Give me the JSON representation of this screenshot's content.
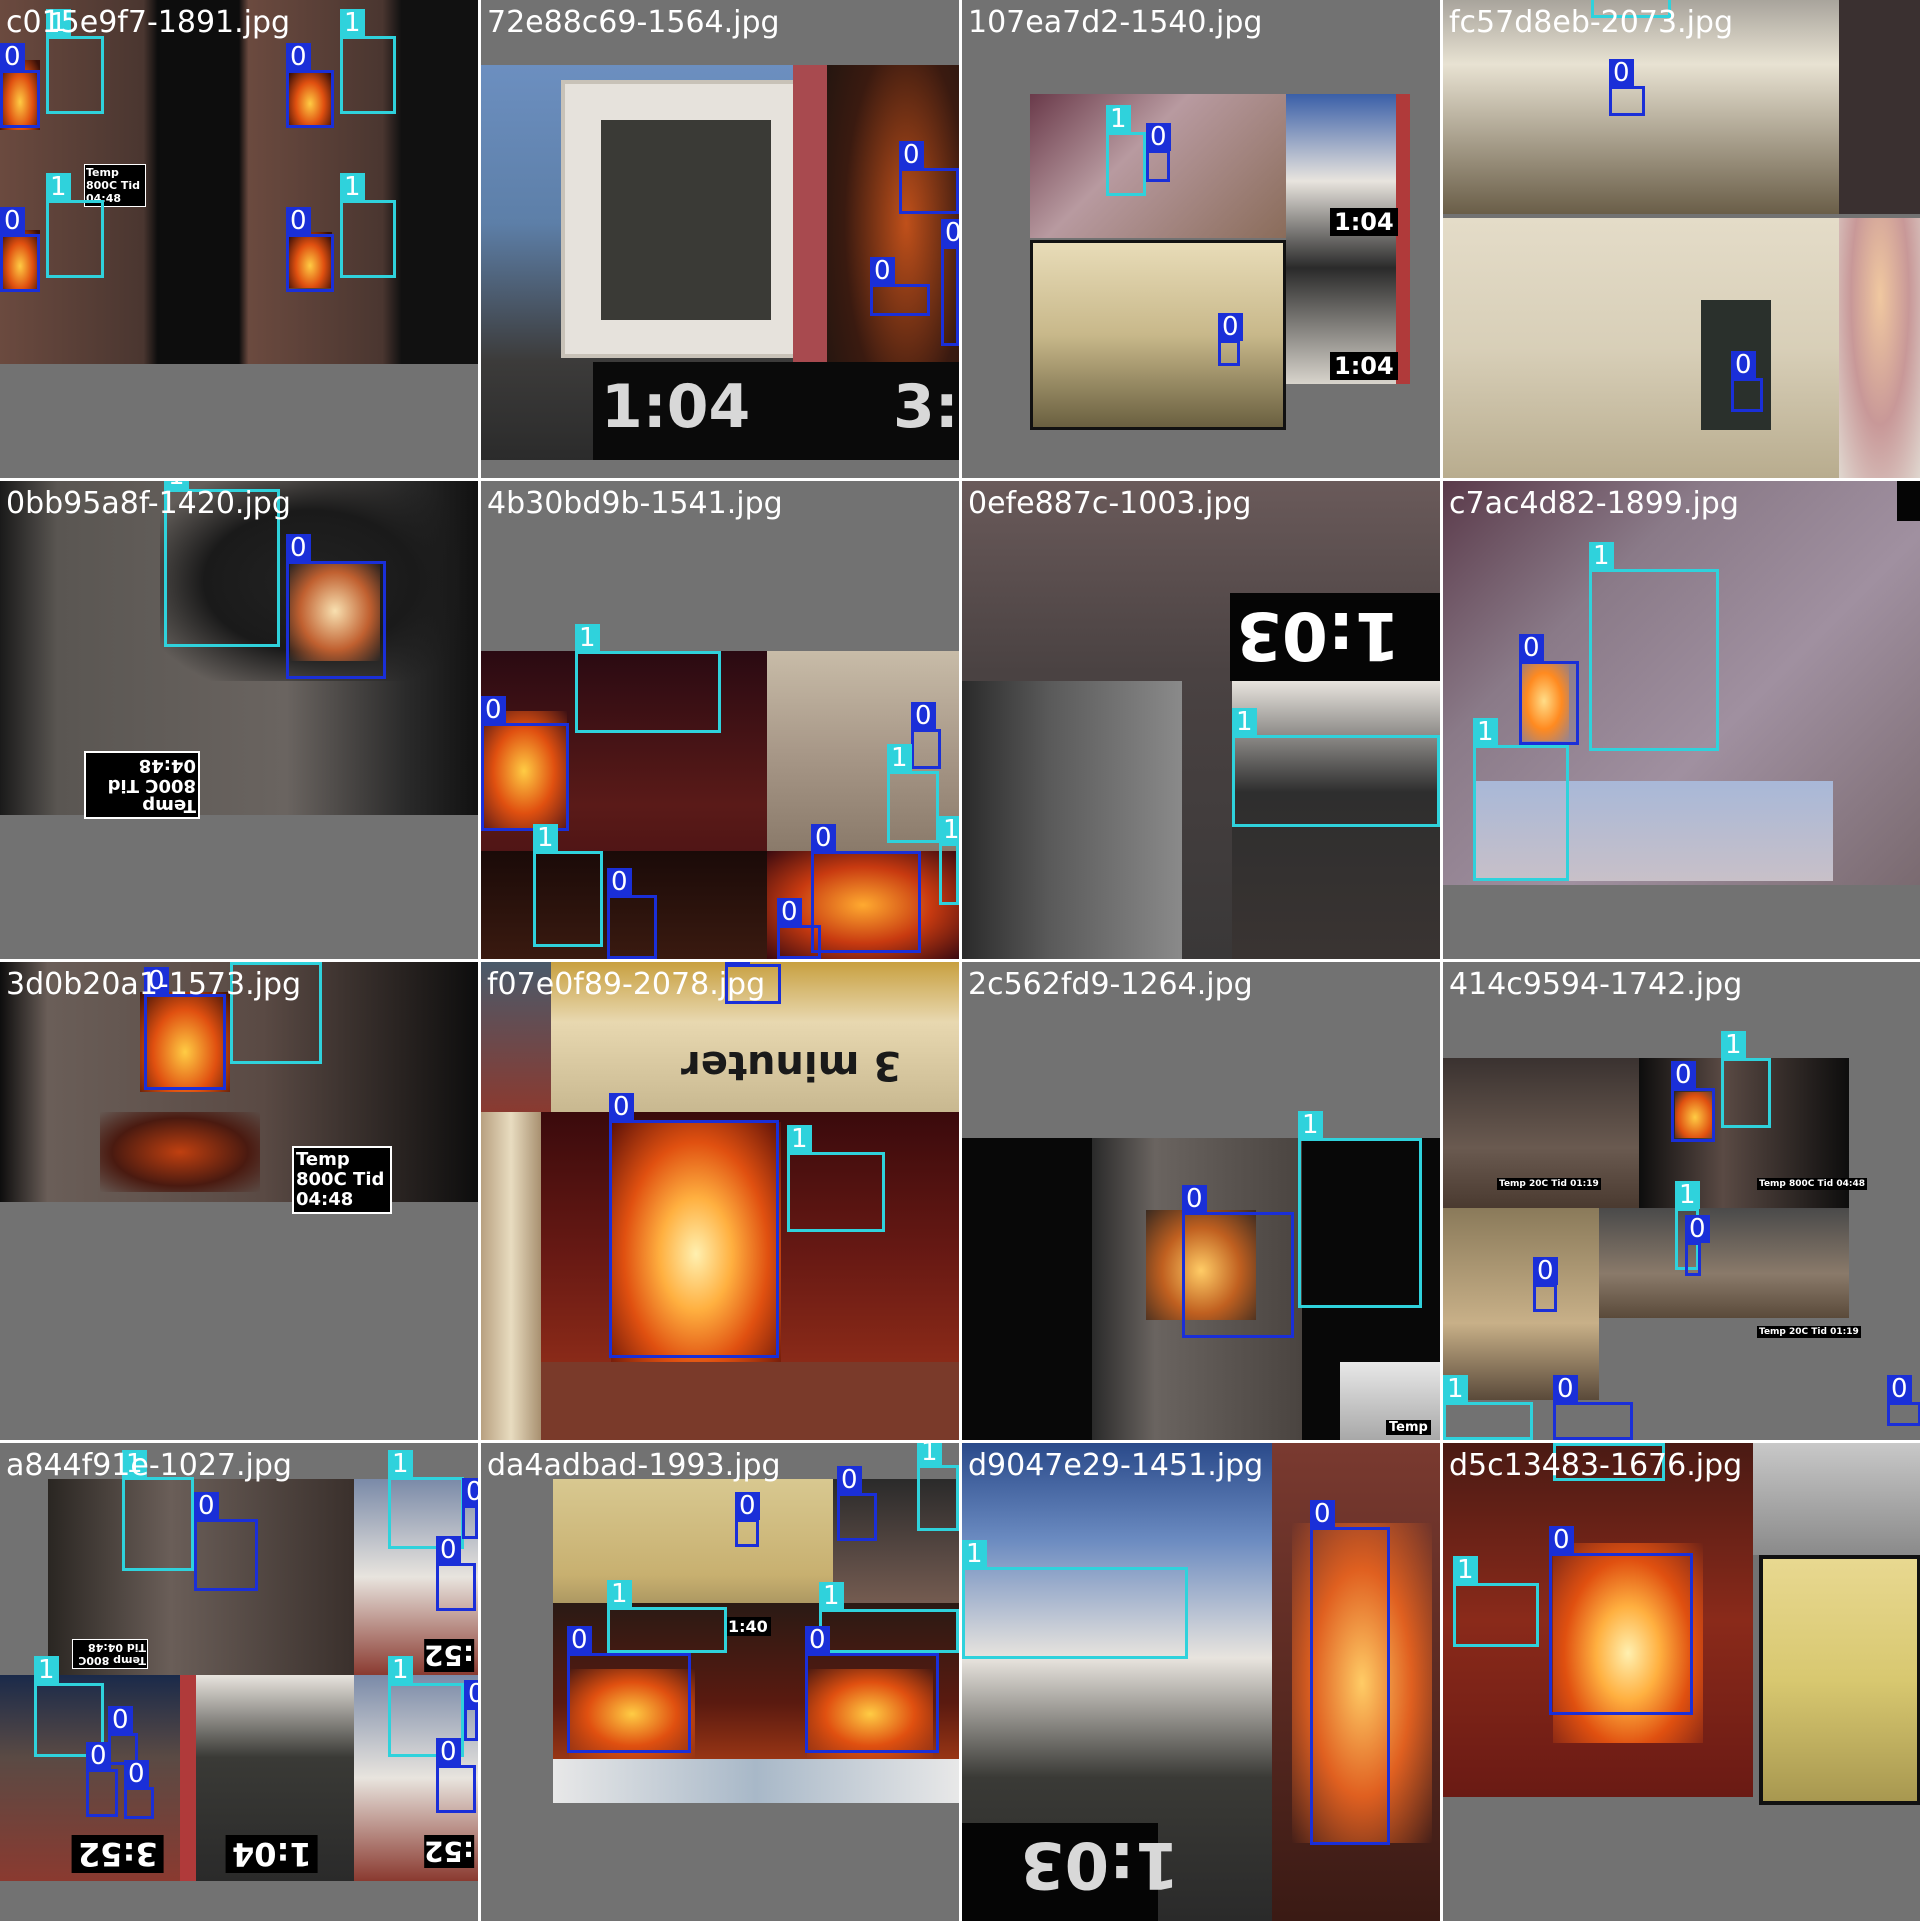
{
  "grid": {
    "tiles": [
      {
        "filename": "c015e9f7-1891.jpg",
        "boxes": [
          "0",
          "1",
          "0",
          "1",
          "0",
          "1",
          "0",
          "1"
        ],
        "overlays": [
          "Temp 800C Tid 04:48"
        ]
      },
      {
        "filename": "72e88c69-1564.jpg",
        "boxes": [
          "0",
          "0",
          "0"
        ],
        "overlays": [
          "1:04",
          "3:5"
        ]
      },
      {
        "filename": "107ea7d2-1540.jpg",
        "boxes": [
          "1",
          "0",
          "0"
        ],
        "overlays": [
          "1:04",
          "1:04"
        ]
      },
      {
        "filename": "fc57d8eb-2073.jpg",
        "boxes": [
          "1",
          "0",
          "0"
        ],
        "overlays": []
      },
      {
        "filename": "0bb95a8f-1420.jpg",
        "boxes": [
          "1",
          "0"
        ],
        "overlays": [
          "Temp 800C Tid 04:48"
        ]
      },
      {
        "filename": "4b30bd9b-1541.jpg",
        "boxes": [
          "1",
          "0",
          "1",
          "0",
          "0",
          "1",
          "0",
          "1",
          "0"
        ],
        "overlays": []
      },
      {
        "filename": "0efe887c-1003.jpg",
        "boxes": [
          "1"
        ],
        "overlays": [
          "1:03"
        ]
      },
      {
        "filename": "c7ac4d82-1899.jpg",
        "boxes": [
          "1",
          "0",
          "1"
        ],
        "overlays": []
      },
      {
        "filename": "3d0b20a1-1573.jpg",
        "boxes": [
          "0",
          "1"
        ],
        "overlays": [
          "Temp 800C Tid 04:48"
        ]
      },
      {
        "filename": "f07e0f89-2078.jpg",
        "boxes": [
          "0",
          "0",
          "1"
        ],
        "overlays": [
          "3 minuter"
        ]
      },
      {
        "filename": "2c562fd9-1264.jpg",
        "boxes": [
          "0",
          "1"
        ],
        "overlays": [
          "Temp"
        ]
      },
      {
        "filename": "414c9594-1742.jpg",
        "boxes": [
          "0",
          "1",
          "1",
          "0",
          "0",
          "1",
          "0",
          "0"
        ],
        "overlays": [
          "Temp 20C Tid 01:19",
          "Temp 800C Tid 04:48",
          "Temp 20C Tid 01:19"
        ]
      },
      {
        "filename": "a844f91e-1027.jpg",
        "boxes": [
          "1",
          "0",
          "1",
          "0",
          "0",
          "1",
          "0",
          "0",
          "0",
          "1",
          "0",
          "0"
        ],
        "overlays": [
          "Temp 800C Tid 04:48",
          ":52",
          "3:52",
          "1:04",
          ":52"
        ]
      },
      {
        "filename": "da4adbad-1993.jpg",
        "boxes": [
          "0",
          "0",
          "1",
          "1",
          "0",
          "1",
          "0"
        ],
        "overlays": [
          "1:40"
        ]
      },
      {
        "filename": "d9047e29-1451.jpg",
        "boxes": [
          "1",
          "0"
        ],
        "overlays": [
          "1:03"
        ]
      },
      {
        "filename": "d5c13483-1676.jpg",
        "boxes": [
          "1",
          "0",
          "1"
        ],
        "overlays": []
      }
    ]
  },
  "colors": {
    "class0": "#1a2fd8",
    "class1": "#2fd2dc",
    "tile_background": "#727272",
    "grid_gap": "#ffffff"
  }
}
